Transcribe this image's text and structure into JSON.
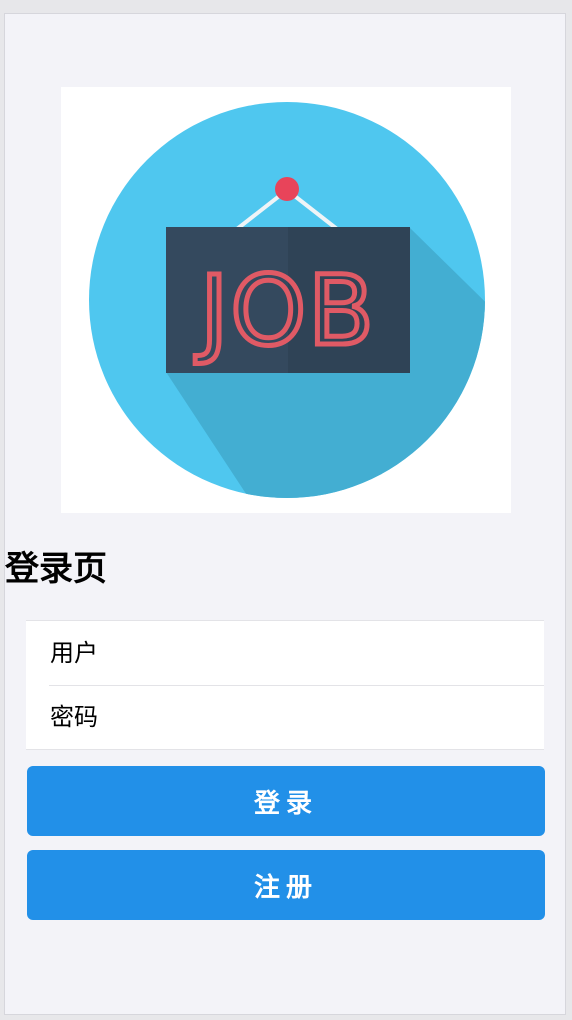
{
  "logo": {
    "text": "JOB",
    "icon": "job-sign-icon",
    "colors": {
      "circle": "#4fc7ef",
      "shadow": "#43aed2",
      "board": "#34495e",
      "letters": "#e05a65",
      "pin": "#e8445a"
    }
  },
  "page": {
    "title": "登录页"
  },
  "form": {
    "username_placeholder": "用户",
    "password_placeholder": "密码"
  },
  "buttons": {
    "login_label": "登录",
    "register_label": "注册",
    "color": "#2290e8"
  }
}
